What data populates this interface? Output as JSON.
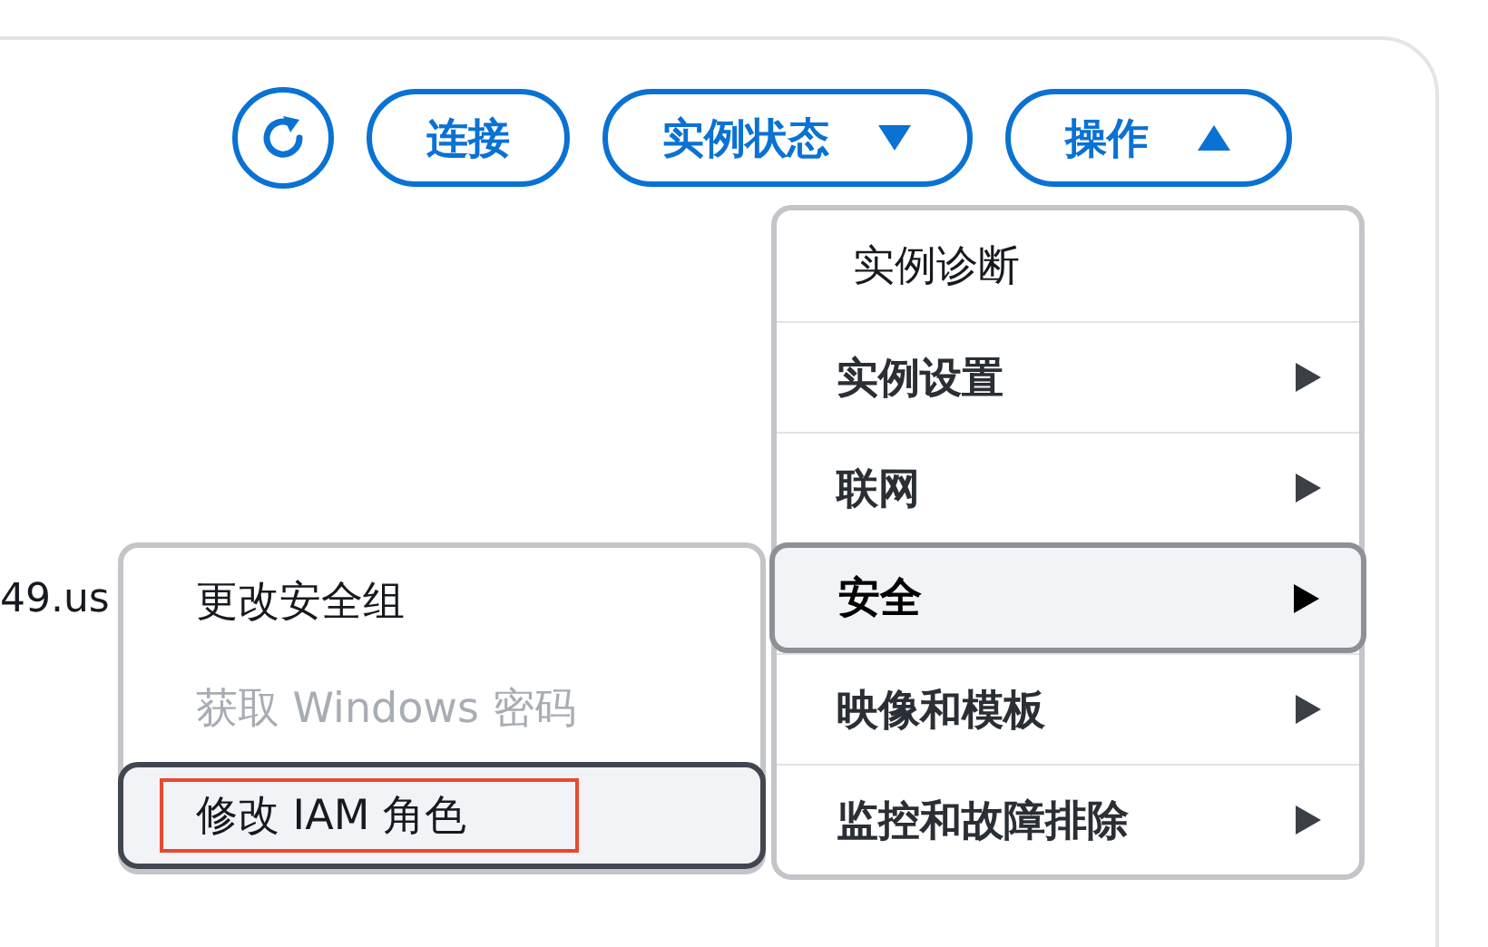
{
  "toolbar": {
    "buttons": [
      {
        "kind": "refresh"
      },
      {
        "kind": "text",
        "label": "连接"
      },
      {
        "kind": "dropdown",
        "label": "实例状态",
        "expanded": false
      },
      {
        "kind": "dropdown",
        "label": "操作",
        "expanded": true
      }
    ]
  },
  "background_text": "49.us",
  "menu": {
    "items": [
      {
        "label": "实例诊断",
        "has_submenu": false,
        "selected": false
      },
      {
        "label": "实例设置",
        "has_submenu": true,
        "selected": false
      },
      {
        "label": "联网",
        "has_submenu": true,
        "selected": false
      },
      {
        "label": "安全",
        "has_submenu": true,
        "selected": true
      },
      {
        "label": "映像和模板",
        "has_submenu": true,
        "selected": false
      },
      {
        "label": "监控和故障排除",
        "has_submenu": true,
        "selected": false
      }
    ]
  },
  "submenu": {
    "items": [
      {
        "label": "更改安全组",
        "disabled": false,
        "selected": false,
        "annotated": false
      },
      {
        "label": "获取 Windows 密码",
        "disabled": true,
        "selected": false,
        "annotated": false
      },
      {
        "label": "修改 IAM 角色",
        "disabled": false,
        "selected": true,
        "annotated": true
      }
    ]
  }
}
